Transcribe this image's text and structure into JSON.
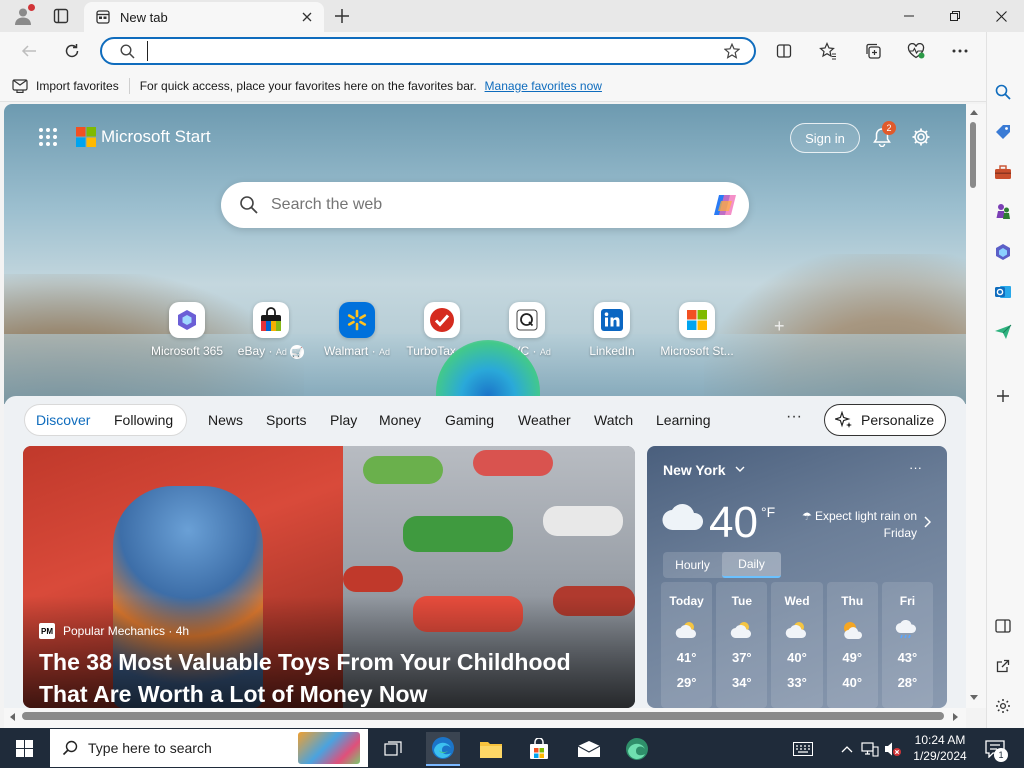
{
  "browser": {
    "tab_title": "New tab",
    "address_value": "",
    "favorites_bar": {
      "import_label": "Import favorites",
      "message": "For quick access, place your favorites here on the favorites bar.",
      "manage_link": "Manage favorites now"
    }
  },
  "page": {
    "brand": "Microsoft Start",
    "sign_in": "Sign in",
    "notification_count": "2",
    "search_placeholder": "Search the web",
    "quick_links": [
      {
        "label": "Microsoft 365",
        "ad": ""
      },
      {
        "label": "eBay",
        "ad": "Ad"
      },
      {
        "label": "Walmart",
        "ad": "Ad"
      },
      {
        "label": "TurboTax",
        "ad": "Ad"
      },
      {
        "label": "QVC",
        "ad": "Ad"
      },
      {
        "label": "LinkedIn",
        "ad": ""
      },
      {
        "label": "Microsoft St...",
        "ad": ""
      }
    ],
    "feed_nav": {
      "pills": [
        "Discover",
        "Following"
      ],
      "items": [
        "News",
        "Sports",
        "Play",
        "Money",
        "Gaming",
        "Weather",
        "Watch",
        "Learning"
      ],
      "more": "···",
      "personalize": "Personalize"
    },
    "article": {
      "source": "Popular Mechanics · 4h",
      "title": "The 38 Most Valuable Toys From Your Childhood That Are Worth a Lot of Money Now"
    },
    "weather": {
      "city": "New York",
      "temp": "40",
      "unit": "°F",
      "alert": "Expect light rain on Friday",
      "tabs": [
        "Hourly",
        "Daily"
      ],
      "days": [
        {
          "day": "Today",
          "hi": "41°",
          "lo": "29°"
        },
        {
          "day": "Tue",
          "hi": "37°",
          "lo": "34°"
        },
        {
          "day": "Wed",
          "hi": "40°",
          "lo": "33°"
        },
        {
          "day": "Thu",
          "hi": "49°",
          "lo": "40°"
        },
        {
          "day": "Fri",
          "hi": "43°",
          "lo": "28°"
        }
      ]
    }
  },
  "taskbar": {
    "search_placeholder": "Type here to search",
    "time": "10:24 AM",
    "date": "1/29/2024",
    "notification_count": "1"
  },
  "colors": {
    "accent": "#0f6cbd",
    "taskbar": "#1f2b3a",
    "badge": "#e05a2b"
  }
}
